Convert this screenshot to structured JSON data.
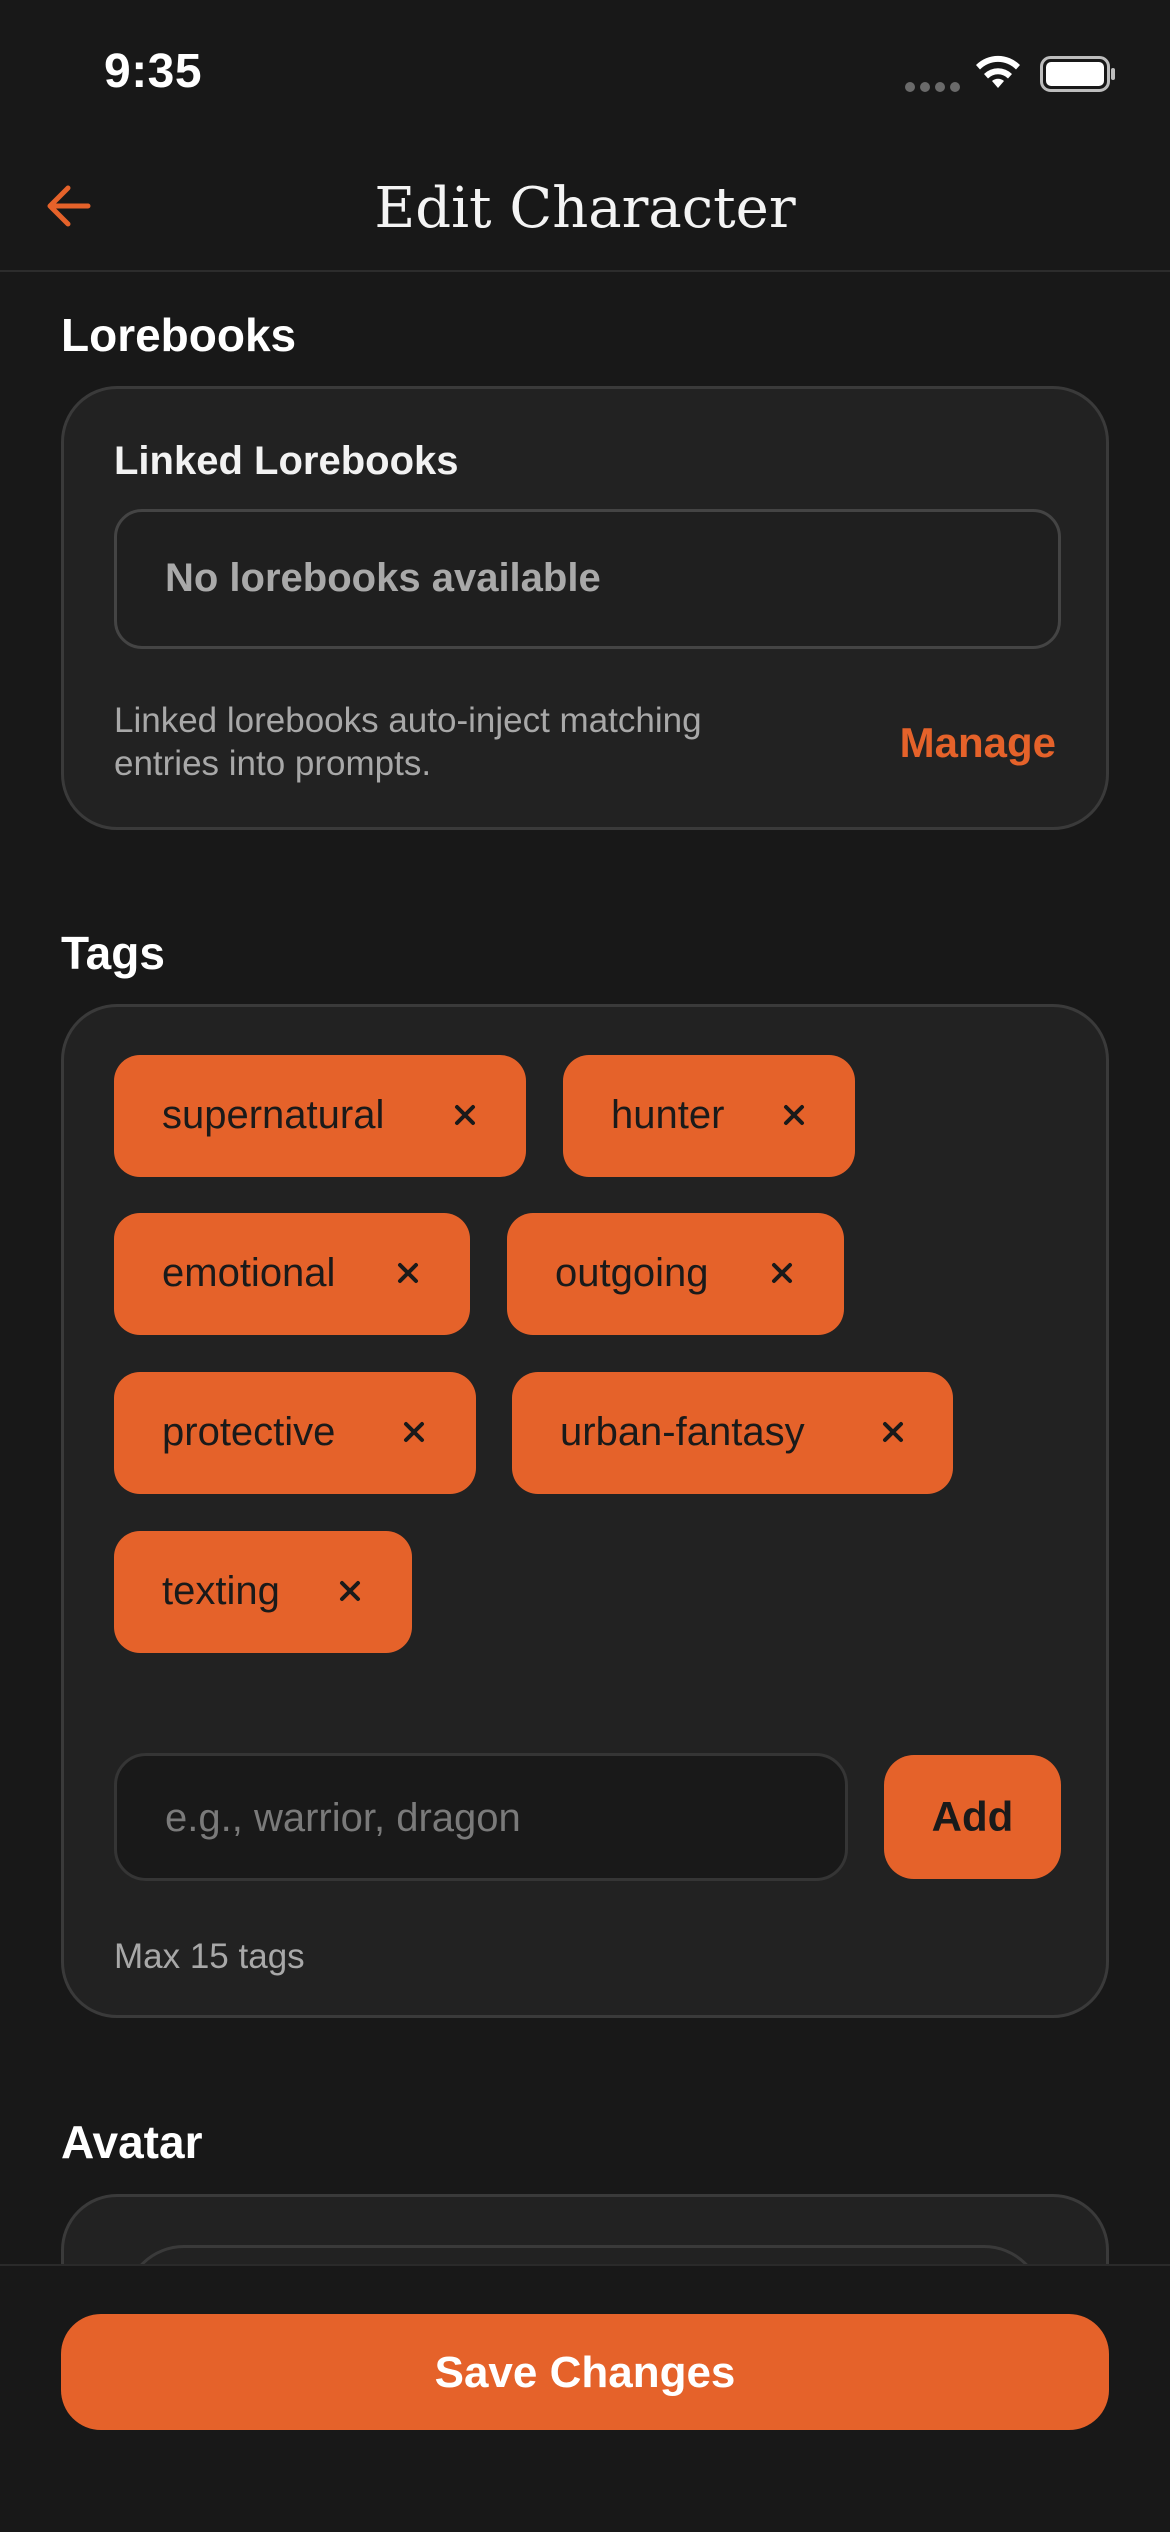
{
  "status_bar": {
    "time": "9:35"
  },
  "header": {
    "title": "Edit Character"
  },
  "lorebooks": {
    "section_title": "Lorebooks",
    "label": "Linked Lorebooks",
    "select_value": "No lorebooks available",
    "helper": "Linked lorebooks auto-inject matching entries into prompts.",
    "manage_label": "Manage"
  },
  "tags": {
    "section_title": "Tags",
    "items": [
      "supernatural",
      "hunter",
      "emotional",
      "outgoing",
      "protective",
      "urban-fantasy",
      "texting"
    ],
    "input_placeholder": "e.g., warrior, dragon",
    "add_label": "Add",
    "max_note": "Max 15 tags"
  },
  "avatar": {
    "section_title": "Avatar"
  },
  "footer": {
    "save_label": "Save Changes"
  },
  "colors": {
    "accent": "#e5622a",
    "background": "#181818",
    "card": "#222222"
  },
  "icons": {
    "back": "arrow-left-icon",
    "remove": "close-icon",
    "wifi": "wifi-icon",
    "battery": "battery-icon",
    "signal": "signal-icon"
  }
}
